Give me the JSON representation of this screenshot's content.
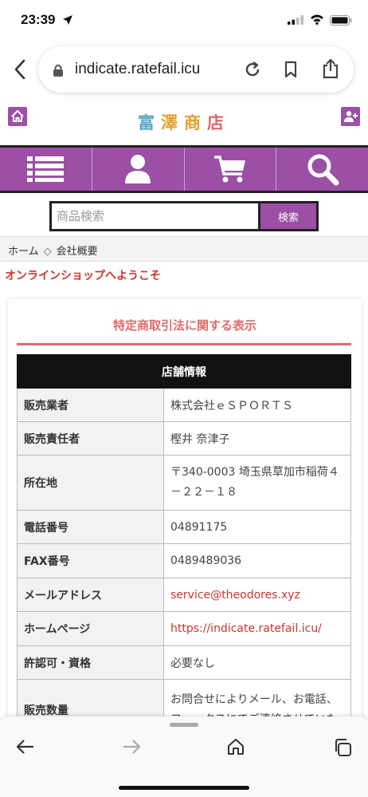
{
  "status": {
    "time": "23:39"
  },
  "browser": {
    "url": "indicate.ratefail.icu"
  },
  "site": {
    "title_chars": [
      "富",
      "澤",
      "商",
      "店"
    ],
    "title_colors": [
      "#5aa4c9",
      "#e0a030",
      "#e0a030",
      "#e06a6a"
    ],
    "accent": "#9b4fa5"
  },
  "nav": {
    "items": [
      {
        "icon": "list-icon"
      },
      {
        "icon": "user-icon"
      },
      {
        "icon": "cart-icon"
      },
      {
        "icon": "search-icon"
      }
    ]
  },
  "search": {
    "placeholder": "商品検索",
    "button_label": "検索"
  },
  "breadcrumb": {
    "home": "ホーム",
    "separator": "◇",
    "current": "会社概要"
  },
  "welcome": "オンラインショップへようこそ",
  "panel": {
    "title": "特定商取引法に関する表示",
    "table_header": "店舗情報",
    "rows": [
      {
        "key": "販売業者",
        "value": "株式会社ｅＳＰＯＲＴＳ"
      },
      {
        "key": "販売責任者",
        "value": "樫井 奈津子"
      },
      {
        "key": "所在地",
        "value": "〒340-0003 埼玉県草加市稲荷４－２２－１８"
      },
      {
        "key": "電話番号",
        "value": "04891175"
      },
      {
        "key": "FAX番号",
        "value": "0489489036"
      },
      {
        "key": "メールアドレス",
        "value": "service@theodores.xyz"
      },
      {
        "key": "ホームページ",
        "value": "https://indicate.ratefail.icu/"
      },
      {
        "key": "許認可・資格",
        "value": "必要なし"
      },
      {
        "key": "販売数量",
        "value": "お問合せによりメール、お電話、ファックスにてご連絡させていた"
      }
    ]
  },
  "colors": {
    "link": "#d0352b",
    "heading": "#e06a6a"
  }
}
